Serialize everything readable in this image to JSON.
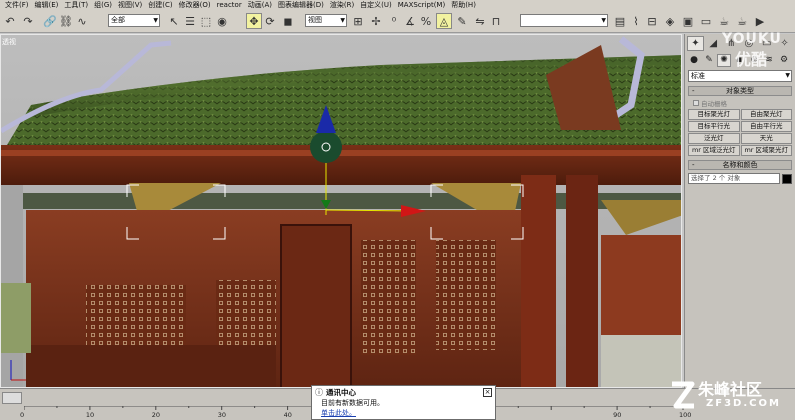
{
  "menu": [
    "文件(F)",
    "编辑(E)",
    "工具(T)",
    "组(G)",
    "视图(V)",
    "创建(C)",
    "修改器(O)",
    "reactor",
    "动画(A)",
    "图表编辑器(D)",
    "渲染(R)",
    "自定义(U)",
    "MAXScript(M)",
    "帮助(H)"
  ],
  "toolbar": {
    "selection_filter": "全部",
    "reference_coord": "视图"
  },
  "viewport": {
    "label": "透视"
  },
  "command_panel": {
    "category_dropdown": "标准",
    "object_type": {
      "title": "对象类型",
      "auto_grid": "自动栅格",
      "buttons": [
        "目标聚光灯",
        "自由聚光灯",
        "目标平行光",
        "自由平行光",
        "泛光灯",
        "天光",
        "mr 区域泛光灯",
        "mr 区域聚光灯"
      ]
    },
    "name_color": {
      "title": "名称和颜色",
      "field": "选择了 2 个 对象",
      "swatch_color": "#000000"
    }
  },
  "timeline": {
    "ticks": [
      "0",
      "10",
      "20",
      "30",
      "40",
      "90",
      "100"
    ]
  },
  "popup": {
    "title": "通讯中心",
    "line1": "目前有新数据可用。",
    "link": "单击此处。"
  },
  "watermarks": {
    "youku_line1": "YOUKU",
    "youku_line2": "优酷",
    "zf_line1": "朱峰社区",
    "zf_line2": "ZF3D.COM"
  }
}
